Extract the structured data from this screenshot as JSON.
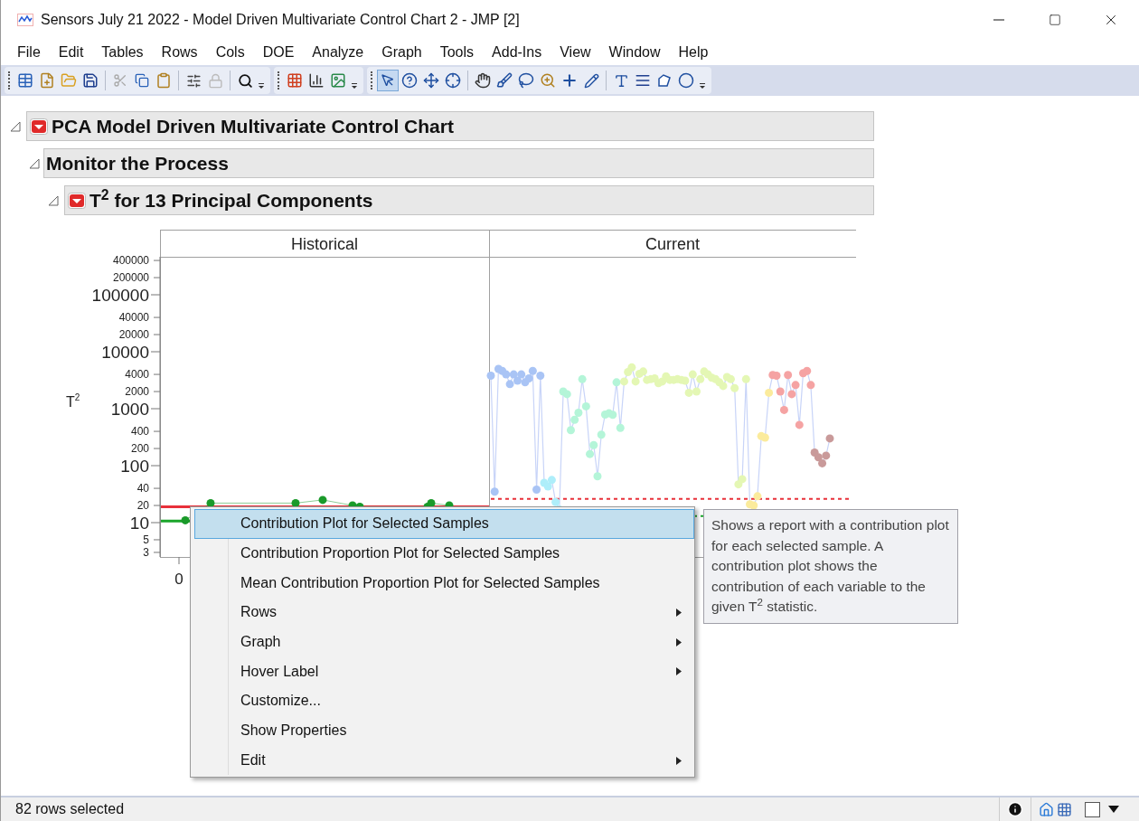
{
  "window": {
    "title": "Sensors July 21 2022 - Model Driven Multivariate Control Chart 2 - JMP [2]"
  },
  "menu_bar": [
    "File",
    "Edit",
    "Tables",
    "Rows",
    "Cols",
    "DOE",
    "Analyze",
    "Graph",
    "Tools",
    "Add-Ins",
    "View",
    "Window",
    "Help"
  ],
  "outline": [
    {
      "title": "PCA Model Driven Multivariate Control Chart",
      "expanded": true,
      "has_menu": true
    },
    {
      "title": "Monitor the Process",
      "expanded": true,
      "has_menu": false
    },
    {
      "title": "T$^{2}$ for 13 Principal Components",
      "expanded": true,
      "has_menu": true
    }
  ],
  "chart": {
    "panels": [
      "Historical",
      "Current"
    ],
    "ylabel": "T$^{2}$",
    "y_ticks": [
      "400000",
      "200000",
      "100000",
      "40000",
      "20000",
      "10000",
      "4000",
      "2000",
      "1000",
      "400",
      "200",
      "100",
      "40",
      "20",
      "10",
      "5",
      "3"
    ],
    "x_ticks": [
      "0"
    ]
  },
  "context_menu": [
    {
      "label": "Contribution Plot for Selected Samples",
      "selected": true,
      "has_submenu": false
    },
    {
      "label": "Contribution Proportion Plot for Selected Samples",
      "selected": false,
      "has_submenu": false
    },
    {
      "label": "Mean Contribution Proportion Plot for Selected Samples",
      "selected": false,
      "has_submenu": false
    },
    {
      "label": "Rows",
      "selected": false,
      "has_submenu": true
    },
    {
      "label": "Graph",
      "selected": false,
      "has_submenu": true
    },
    {
      "label": "Hover Label",
      "selected": false,
      "has_submenu": true
    },
    {
      "label": "Customize...",
      "selected": false,
      "has_submenu": false
    },
    {
      "label": "Show Properties",
      "selected": false,
      "has_submenu": false
    },
    {
      "label": "Edit",
      "selected": false,
      "has_submenu": true
    }
  ],
  "tooltip": "Shows a report with a contribution plot for each selected sample. A contribution plot shows the contribution of each variable to the given T$^{2}$ statistic.",
  "status_bar": {
    "text": "82 rows selected"
  }
}
